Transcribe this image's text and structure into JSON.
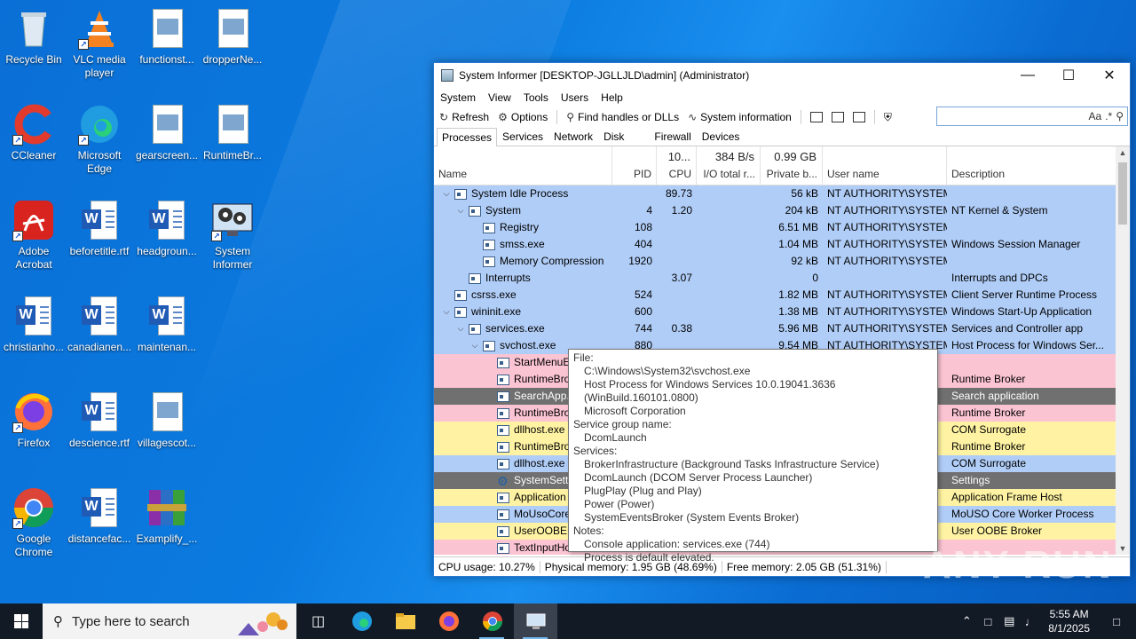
{
  "desktop": {
    "icons": [
      {
        "label": "Recycle Bin"
      },
      {
        "label": "VLC media player"
      },
      {
        "label": "functionst..."
      },
      {
        "label": "dropperNe..."
      },
      {
        "label": "CCleaner"
      },
      {
        "label": "Microsoft Edge"
      },
      {
        "label": "gearscreen..."
      },
      {
        "label": "RuntimeBr..."
      },
      {
        "label": "Adobe Acrobat"
      },
      {
        "label": "beforetitle.rtf"
      },
      {
        "label": "headgroun..."
      },
      {
        "label": "System Informer"
      },
      {
        "label": "christianho..."
      },
      {
        "label": "canadianen..."
      },
      {
        "label": "maintenan..."
      },
      {
        "label": "Firefox"
      },
      {
        "label": "descience.rtf"
      },
      {
        "label": "villagescot..."
      },
      {
        "label": "Google Chrome"
      },
      {
        "label": "distancefac..."
      },
      {
        "label": "Examplify_..."
      }
    ]
  },
  "window": {
    "title": "System Informer [DESKTOP-JGLLJLD\\admin] (Administrator)",
    "menu": [
      "System",
      "View",
      "Tools",
      "Users",
      "Help"
    ],
    "toolbar": {
      "refresh": "Refresh",
      "options": "Options",
      "find_handles": "Find handles or DLLs",
      "system_information": "System information"
    },
    "search": {
      "placeholder": "",
      "case_label": "Aa",
      "regex_label": ".*"
    },
    "tabs": [
      "Processes",
      "Services",
      "Network",
      "Disk",
      "Firewall",
      "Devices"
    ],
    "columns": {
      "name": "Name",
      "pid": "PID",
      "cpu_total": "10...",
      "cpu": "CPU",
      "io_total": "384 B/s",
      "io": "I/O total r...",
      "private_total": "0.99 GB",
      "private": "Private b...",
      "user": "User name",
      "description": "Description"
    },
    "rows": [
      {
        "name": "System Idle Process",
        "indent": 0,
        "expander": "v",
        "pid": "",
        "cpu": "89.73",
        "io": "",
        "priv": "56 kB",
        "user": "NT AUTHORITY\\SYSTEM",
        "desc": "",
        "color": "#b0cdf7"
      },
      {
        "name": "System",
        "indent": 1,
        "expander": "v",
        "pid": "4",
        "cpu": "1.20",
        "io": "",
        "priv": "204 kB",
        "user": "NT AUTHORITY\\SYSTEM",
        "desc": "NT Kernel & System",
        "color": "#b0cdf7"
      },
      {
        "name": "Registry",
        "indent": 2,
        "expander": "",
        "pid": "108",
        "cpu": "",
        "io": "",
        "priv": "6.51 MB",
        "user": "NT AUTHORITY\\SYSTEM",
        "desc": "",
        "color": "#b0cdf7"
      },
      {
        "name": "smss.exe",
        "indent": 2,
        "expander": "",
        "pid": "404",
        "cpu": "",
        "io": "",
        "priv": "1.04 MB",
        "user": "NT AUTHORITY\\SYSTEM",
        "desc": "Windows Session Manager",
        "color": "#b0cdf7"
      },
      {
        "name": "Memory Compression",
        "indent": 2,
        "expander": "",
        "pid": "1920",
        "cpu": "",
        "io": "",
        "priv": "92 kB",
        "user": "NT AUTHORITY\\SYSTEM",
        "desc": "",
        "color": "#b0cdf7"
      },
      {
        "name": "Interrupts",
        "indent": 1,
        "expander": "",
        "pid": "",
        "cpu": "3.07",
        "io": "",
        "priv": "0",
        "user": "",
        "desc": "Interrupts and DPCs",
        "color": "#b0cdf7"
      },
      {
        "name": "csrss.exe",
        "indent": 0,
        "expander": "",
        "pid": "524",
        "cpu": "",
        "io": "",
        "priv": "1.82 MB",
        "user": "NT AUTHORITY\\SYSTEM",
        "desc": "Client Server Runtime Process",
        "color": "#b0cdf7"
      },
      {
        "name": "wininit.exe",
        "indent": 0,
        "expander": "v",
        "pid": "600",
        "cpu": "",
        "io": "",
        "priv": "1.38 MB",
        "user": "NT AUTHORITY\\SYSTEM",
        "desc": "Windows Start-Up Application",
        "color": "#b0cdf7"
      },
      {
        "name": "services.exe",
        "indent": 1,
        "expander": "v",
        "pid": "744",
        "cpu": "0.38",
        "io": "",
        "priv": "5.96 MB",
        "user": "NT AUTHORITY\\SYSTEM",
        "desc": "Services and Controller app",
        "color": "#b0cdf7"
      },
      {
        "name": "svchost.exe",
        "indent": 2,
        "expander": "v",
        "pid": "880",
        "cpu": "",
        "io": "",
        "priv": "9.54 MB",
        "user": "NT AUTHORITY\\SYSTEM",
        "desc": "Host Process for Windows Ser...",
        "color": "#b0cdf7"
      },
      {
        "name": "StartMenuE",
        "indent": 3,
        "expander": "",
        "pid": "",
        "cpu": "",
        "io": "",
        "priv": "",
        "user": "i",
        "desc": "",
        "color": "#fbc4d2"
      },
      {
        "name": "RuntimeBro",
        "indent": 3,
        "expander": "",
        "pid": "",
        "cpu": "",
        "io": "",
        "priv": "",
        "user": "i",
        "desc": "Runtime Broker",
        "color": "#fbc4d2"
      },
      {
        "name": "SearchApp.",
        "indent": 3,
        "expander": "",
        "pid": "",
        "cpu": "",
        "io": "",
        "priv": "",
        "user": "i",
        "desc": "Search application",
        "color": "#707070"
      },
      {
        "name": "RuntimeBro",
        "indent": 3,
        "expander": "",
        "pid": "",
        "cpu": "",
        "io": "",
        "priv": "",
        "user": "i",
        "desc": "Runtime Broker",
        "color": "#fbc4d2"
      },
      {
        "name": "dllhost.exe",
        "indent": 3,
        "expander": "",
        "pid": "",
        "cpu": "",
        "io": "",
        "priv": "",
        "user": "i",
        "desc": "COM Surrogate",
        "color": "#fff3a3"
      },
      {
        "name": "RuntimeBro",
        "indent": 3,
        "expander": "",
        "pid": "",
        "cpu": "",
        "io": "",
        "priv": "",
        "user": "i",
        "desc": "Runtime Broker",
        "color": "#fff3a3"
      },
      {
        "name": "dllhost.exe",
        "indent": 3,
        "expander": "",
        "pid": "",
        "cpu": "",
        "io": "",
        "priv": "",
        "user": "i",
        "desc": "COM Surrogate",
        "color": "#b0cdf7"
      },
      {
        "name": "SystemSetti",
        "indent": 3,
        "expander": "",
        "pid": "",
        "cpu": "",
        "io": "",
        "priv": "",
        "user": "i",
        "desc": "Settings",
        "color": "#707070",
        "gear": true
      },
      {
        "name": "Application",
        "indent": 3,
        "expander": "",
        "pid": "",
        "cpu": "",
        "io": "",
        "priv": "",
        "user": "i",
        "desc": "Application Frame Host",
        "color": "#fff3a3"
      },
      {
        "name": "MoUsoCore",
        "indent": 3,
        "expander": "",
        "pid": "",
        "cpu": "",
        "io": "",
        "priv": "",
        "user": "i",
        "desc": "MoUSO Core Worker Process",
        "color": "#b0cdf7"
      },
      {
        "name": "UserOOBEB",
        "indent": 3,
        "expander": "",
        "pid": "",
        "cpu": "",
        "io": "",
        "priv": "",
        "user": "i",
        "desc": "User OOBE Broker",
        "color": "#fff3a3"
      },
      {
        "name": "TextInputHo",
        "indent": 3,
        "expander": "",
        "pid": "",
        "cpu": "",
        "io": "",
        "priv": "",
        "user": "",
        "desc": "",
        "color": "#fbc4d2"
      }
    ],
    "status": {
      "cpu": "CPU usage: 10.27%",
      "physical": "Physical memory: 1.95 GB (48.69%)",
      "free": "Free memory: 2.05 GB (51.31%)"
    }
  },
  "tooltip": {
    "file_label": "File:",
    "file_path": "C:\\Windows\\System32\\svchost.exe",
    "file_desc": "Host Process for Windows Services 10.0.19041.3636 (WinBuild.160101.0800)",
    "company": "Microsoft Corporation",
    "group_label": "Service group name:",
    "group": "DcomLaunch",
    "services_label": "Services:",
    "services": [
      "BrokerInfrastructure (Background Tasks Infrastructure Service)",
      "DcomLaunch (DCOM Server Process Launcher)",
      "PlugPlay (Plug and Play)",
      "Power (Power)",
      "SystemEventsBroker (System Events Broker)"
    ],
    "notes_label": "Notes:",
    "notes": [
      "Console application: services.exe (744)",
      "Process is default elevated."
    ]
  },
  "taskbar": {
    "search_placeholder": "Type here to search",
    "time": "5:55 AM",
    "date": "8/1/2025"
  },
  "watermark": "ANY RUN"
}
